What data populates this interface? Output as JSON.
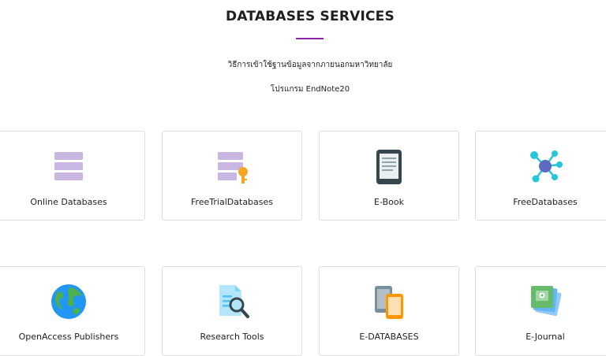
{
  "header": {
    "title": "DATABASES SERVICES",
    "links": [
      "วิธีการเข้าใช้ฐานข้อมูลจากภายนอกมหาวิทยาลัย",
      "โปรแกรม EndNote20"
    ]
  },
  "accent_color": "#8e24aa",
  "cards": [
    {
      "label": "Online Databases",
      "icon": "database-icon"
    },
    {
      "label": "FreeTrialDatabases",
      "icon": "database-key-icon"
    },
    {
      "label": "E-Book",
      "icon": "ebook-reader-icon"
    },
    {
      "label": "FreeDatabases",
      "icon": "network-nodes-icon"
    },
    {
      "label": "OpenAccess Publishers",
      "icon": "globe-icon"
    },
    {
      "label": "Research Tools",
      "icon": "document-search-icon"
    },
    {
      "label": "E-DATABASES",
      "icon": "devices-icon"
    },
    {
      "label": "E-Journal",
      "icon": "photo-stack-icon"
    }
  ]
}
